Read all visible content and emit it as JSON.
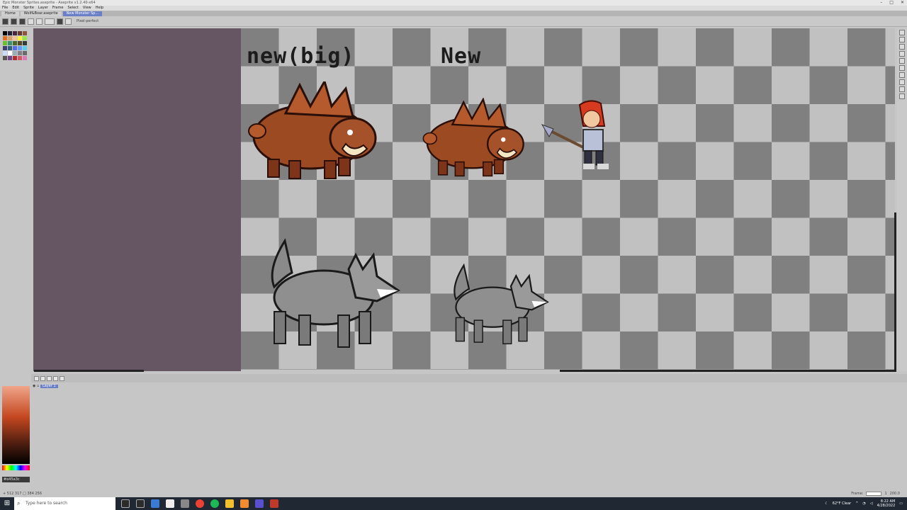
{
  "window": {
    "title": "Epic Monster Sprites.aseprite - Aseprite v1.2.40-x64",
    "controls": [
      "–",
      "□",
      "✕"
    ]
  },
  "menu": [
    "File",
    "Edit",
    "Sprite",
    "Layer",
    "Frame",
    "Select",
    "View",
    "Help"
  ],
  "tabs": [
    {
      "label": "Home",
      "active": false
    },
    {
      "label": "Wolf&Boar.aseprite",
      "active": false
    },
    {
      "label": "New Monster Sp...",
      "active": true
    }
  ],
  "toolbar": {
    "option_label": "Pixel-perfect"
  },
  "canvas": {
    "labels": {
      "big": "new(big)",
      "small": "New"
    },
    "sprites": [
      "boar-big",
      "boar-small",
      "warrior-girl",
      "wolf-big",
      "wolf-small"
    ]
  },
  "layers": {
    "layer_name": "Layer 1"
  },
  "color": {
    "hex": "#e45a3c",
    "palette": [
      "#000000",
      "#222034",
      "#45283c",
      "#663931",
      "#8f563b",
      "#df7126",
      "#d9a066",
      "#eec39a",
      "#fbf236",
      "#99e550",
      "#6abe30",
      "#37946e",
      "#4b692f",
      "#524b24",
      "#323c39",
      "#3f3f74",
      "#306082",
      "#5b6ee1",
      "#639bff",
      "#5fcde4",
      "#cbdbfc",
      "#ffffff",
      "#9badb7",
      "#847e87",
      "#696a6a",
      "#595652",
      "#76428a",
      "#ac3232",
      "#d95763",
      "#d77bba"
    ]
  },
  "status": {
    "left": "+ 512 317  □ 384 256",
    "frame_label": "Frame:",
    "frame_value": "1",
    "zoom_value": "200.0"
  },
  "taskbar": {
    "search_placeholder": "Type here to search",
    "weather": "62°F Clear",
    "time": "8:22 AM",
    "date": "4/28/2022"
  }
}
